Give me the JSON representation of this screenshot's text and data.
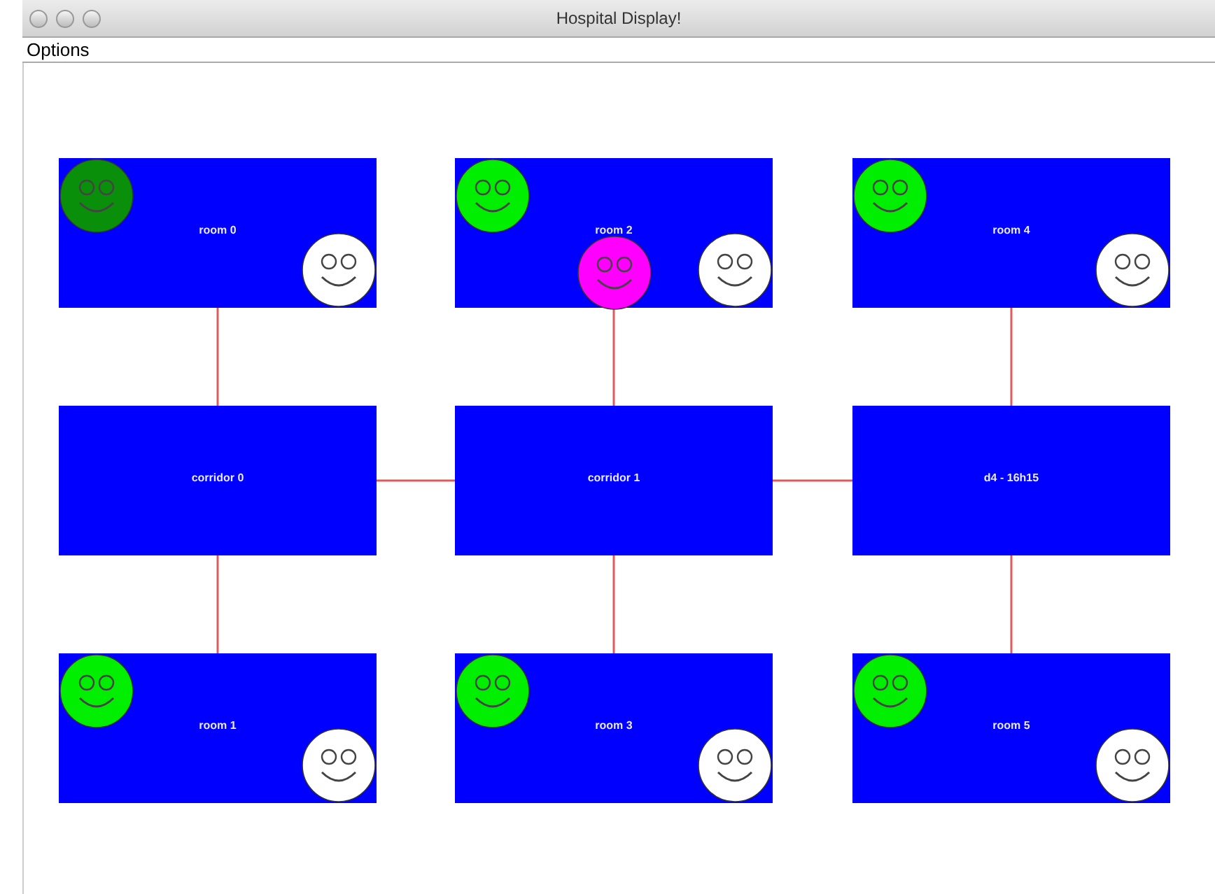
{
  "window": {
    "title": "Hospital Display!"
  },
  "menu": [
    {
      "label": "Options"
    }
  ],
  "nodes": [
    {
      "label": "room 0",
      "patients": [
        {
          "color": "#0a8f0a"
        },
        {
          "color": "#ffffff"
        }
      ]
    },
    {
      "label": "room 2",
      "patients": [
        {
          "color": "#00ee00"
        },
        {
          "color": "#ff00ff"
        },
        {
          "color": "#ffffff"
        }
      ]
    },
    {
      "label": "room 4",
      "patients": [
        {
          "color": "#00ee00"
        },
        {
          "color": "#ffffff"
        }
      ]
    },
    {
      "label": "corridor 0"
    },
    {
      "label": "corridor 1"
    },
    {
      "label": "d4 - 16h15"
    },
    {
      "label": "room 1",
      "patients": [
        {
          "color": "#00ee00"
        },
        {
          "color": "#ffffff"
        }
      ]
    },
    {
      "label": "room 3",
      "patients": [
        {
          "color": "#00ee00"
        },
        {
          "color": "#ffffff"
        }
      ]
    },
    {
      "label": "room 5",
      "patients": [
        {
          "color": "#00ee00"
        },
        {
          "color": "#ffffff"
        }
      ]
    }
  ]
}
